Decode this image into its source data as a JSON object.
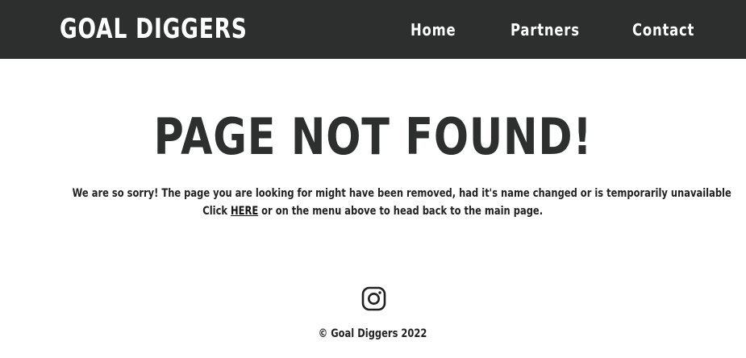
{
  "header": {
    "brand": "GOAL DIGGERS",
    "nav": {
      "home": "Home",
      "partners": "Partners",
      "contact": "Contact"
    }
  },
  "main": {
    "headline": "PAGE NOT FOUND!",
    "message_line1": "We are so sorry! The page you are looking for might have been removed, had it's name changed or is temporarily unavailable",
    "message_line2_prefix": "Click",
    "message_link": "HERE",
    "message_line2_suffix": "or on the menu above to head back to the main page."
  },
  "footer": {
    "social_icon": "instagram-icon",
    "copyright_symbol": "©",
    "copyright_text": "Goal Diggers 2022"
  },
  "colors": {
    "nav_background": "#2d2e2e",
    "nav_text": "#ffffff",
    "headline": "#2d2e2e",
    "body_text": "#222222"
  }
}
